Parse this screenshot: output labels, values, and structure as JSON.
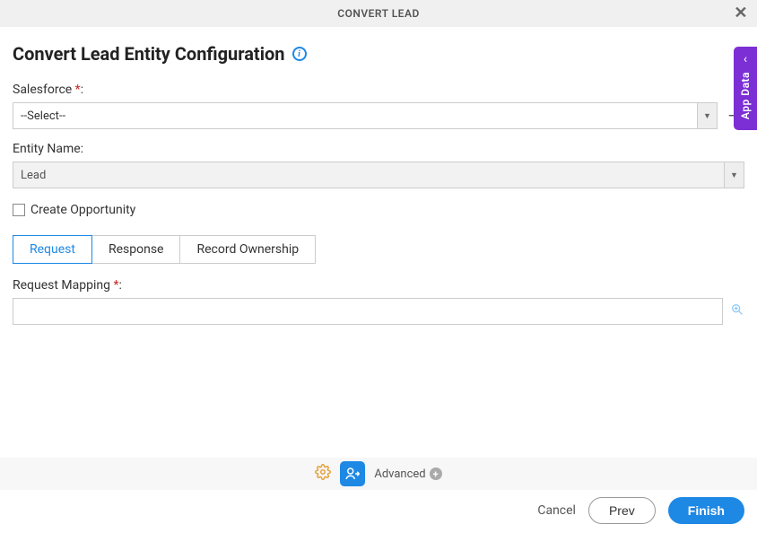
{
  "header": {
    "title": "CONVERT LEAD"
  },
  "page": {
    "title": "Convert Lead Entity Configuration"
  },
  "form": {
    "salesforce": {
      "label_prefix": "Salesforce ",
      "required": "*",
      "label_suffix": ":",
      "value": "--Select--"
    },
    "entityName": {
      "label": "Entity Name:",
      "value": "Lead"
    },
    "createOpportunity": {
      "label": "Create Opportunity",
      "checked": false
    }
  },
  "tabs": [
    {
      "label": "Request",
      "active": true
    },
    {
      "label": "Response",
      "active": false
    },
    {
      "label": "Record Ownership",
      "active": false
    }
  ],
  "requestMapping": {
    "label_prefix": "Request Mapping ",
    "required": "*",
    "label_suffix": ":",
    "value": ""
  },
  "footer": {
    "advanced": "Advanced"
  },
  "buttons": {
    "cancel": "Cancel",
    "prev": "Prev",
    "finish": "Finish"
  },
  "sideTab": {
    "label": "App Data"
  }
}
